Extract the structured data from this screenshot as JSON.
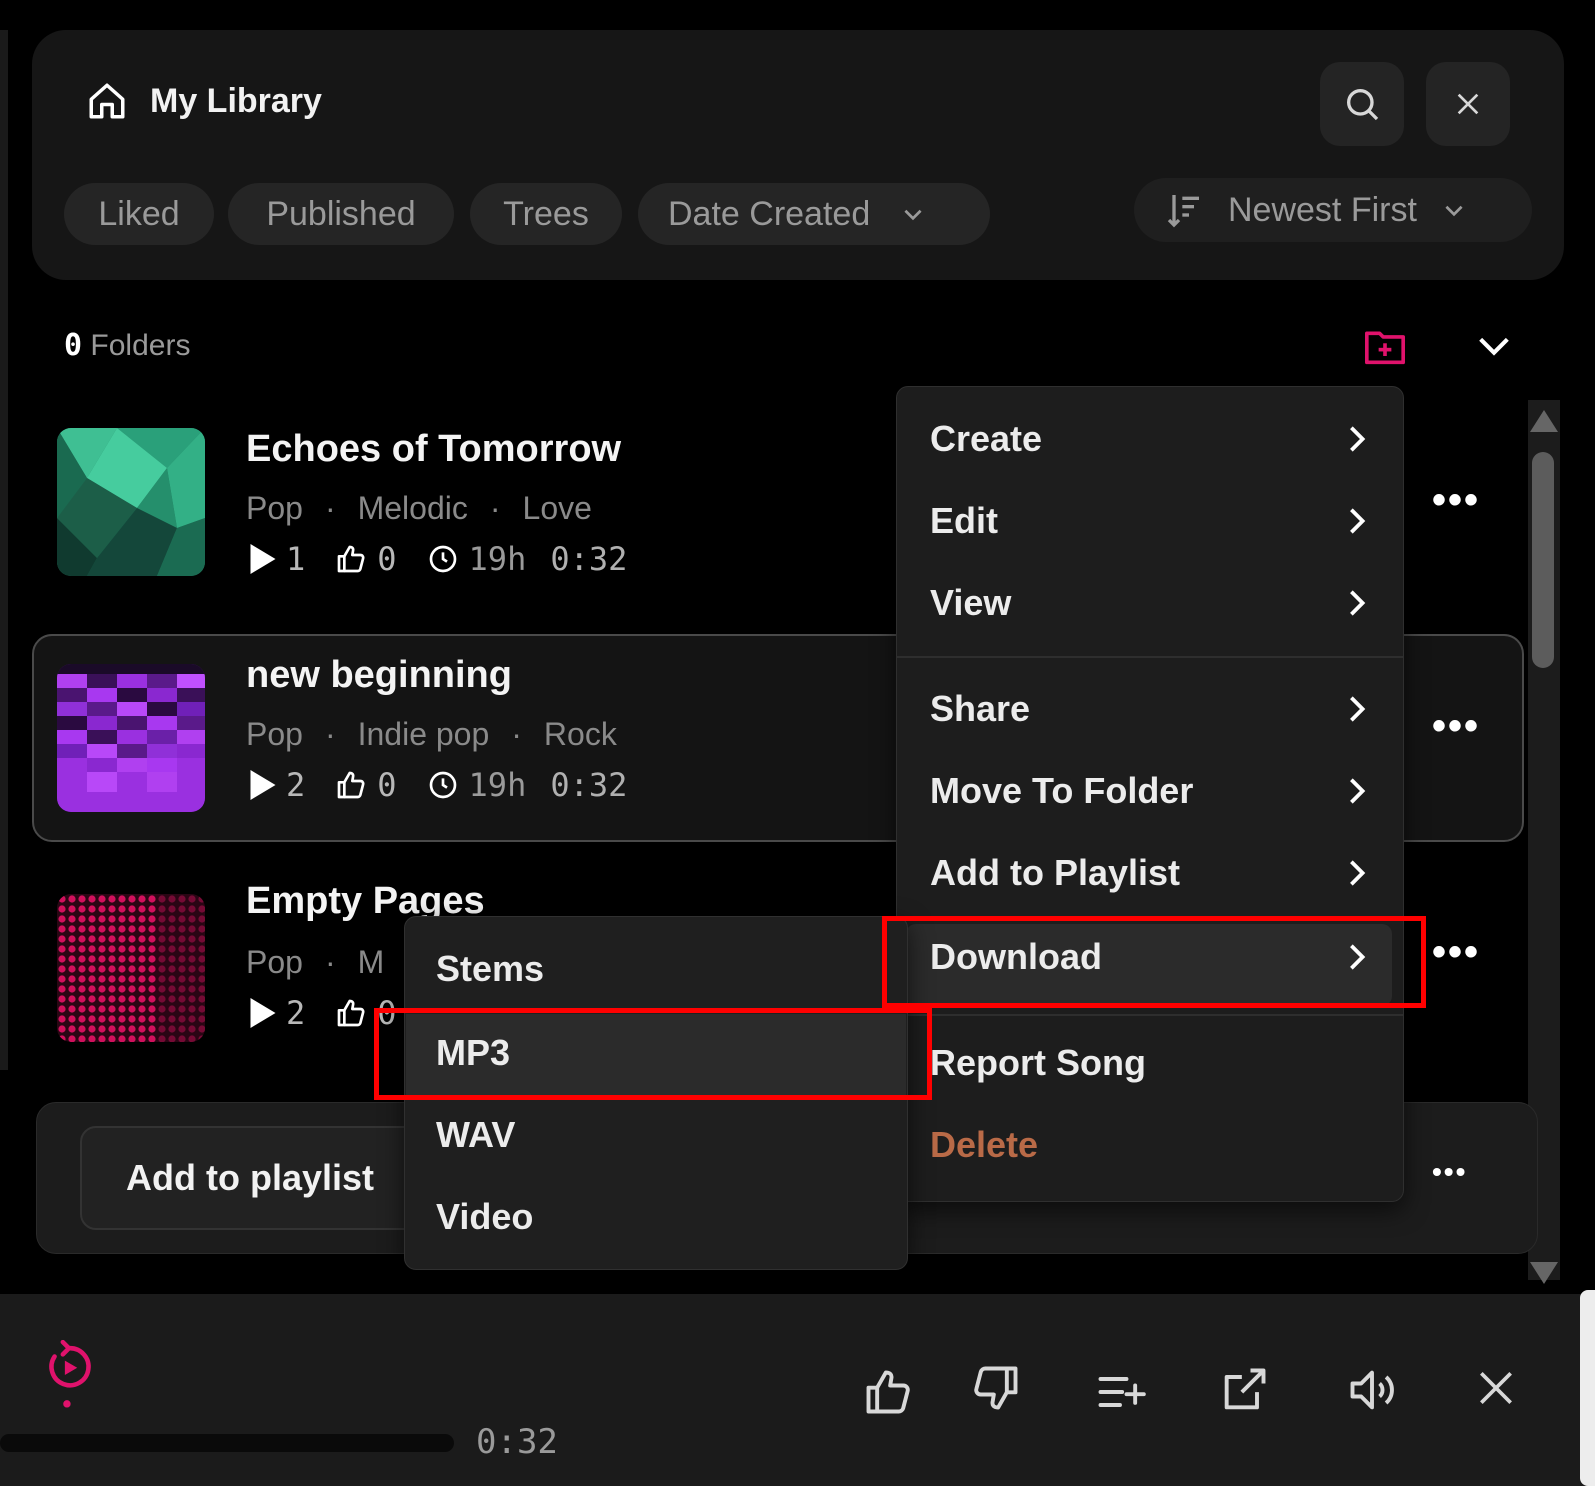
{
  "header": {
    "title": "My Library",
    "filters": [
      "Liked",
      "Published",
      "Trees"
    ],
    "date_filter": "Date Created",
    "sort": "Newest First"
  },
  "folders": {
    "count": "0",
    "label": "Folders"
  },
  "songs": [
    {
      "title": "Echoes of Tomorrow",
      "tags": [
        "Pop",
        "Melodic",
        "Love"
      ],
      "plays": "1",
      "likes": "0",
      "age": "19h",
      "duration": "0:32"
    },
    {
      "title": "new beginning",
      "tags": [
        "Pop",
        "Indie pop",
        "Rock"
      ],
      "plays": "2",
      "likes": "0",
      "age": "19h",
      "duration": "0:32"
    },
    {
      "title": "Empty Pages",
      "tags": [
        "Pop",
        "M"
      ],
      "plays": "2",
      "likes": "0"
    }
  ],
  "action_bar": {
    "add_to_playlist": "Add to playlist"
  },
  "context_menu": {
    "items": [
      "Create",
      "Edit",
      "View",
      "Share",
      "Move To Folder",
      "Add to Playlist",
      "Download",
      "Report Song",
      "Delete"
    ]
  },
  "download_submenu": {
    "items": [
      "Stems",
      "MP3",
      "WAV",
      "Video"
    ]
  },
  "player": {
    "time": "0:32"
  },
  "colors": {
    "accent": "#e0126c",
    "delete": "#b96a47",
    "highlight": "#ff0000"
  }
}
